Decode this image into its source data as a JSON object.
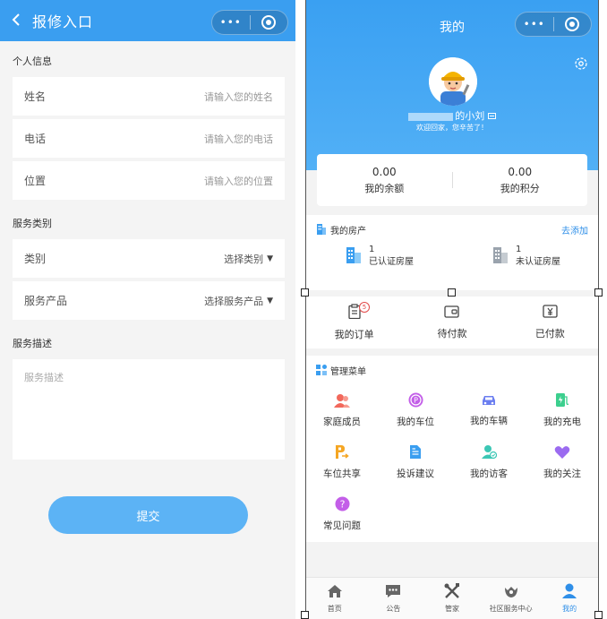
{
  "left": {
    "nav": {
      "back_icon": "chevron-left-icon",
      "title": "报修入口",
      "capsule_dots": "•••"
    },
    "personal": {
      "section_title": "个人信息",
      "fields": [
        {
          "label": "姓名",
          "placeholder": "请输入您的姓名"
        },
        {
          "label": "电话",
          "placeholder": "请输入您的电话"
        },
        {
          "label": "位置",
          "placeholder": "请输入您的位置"
        }
      ]
    },
    "service": {
      "section_title": "服务类别",
      "fields": [
        {
          "label": "类别",
          "value": "选择类别",
          "caret": "▼"
        },
        {
          "label": "服务产品",
          "value": "选择服务产品",
          "caret": "▼"
        }
      ]
    },
    "description": {
      "section_title": "服务描述",
      "placeholder": "服务描述"
    },
    "submit_label": "提交",
    "accent": "#3a9ef0"
  },
  "right": {
    "nav": {
      "title": "我的",
      "capsule_dots": "•••"
    },
    "profile": {
      "name_suffix": "的小刘",
      "verified_icon": "id-card-icon",
      "welcome": "欢迎回家，您辛苦了！"
    },
    "stats": [
      {
        "value": "0.00",
        "label": "我的余额"
      },
      {
        "value": "0.00",
        "label": "我的积分"
      }
    ],
    "property": {
      "title": "我的房产",
      "add_label": "去添加",
      "items": [
        {
          "count": "1",
          "label": "已认证房屋",
          "icon": "building-icon"
        },
        {
          "count": "1",
          "label": "未认证房屋",
          "icon": "building-gray-icon"
        }
      ]
    },
    "orders": [
      {
        "label": "我的订单",
        "icon": "clipboard-icon",
        "badge": "5"
      },
      {
        "label": "待付款",
        "icon": "wallet-icon"
      },
      {
        "label": "已付款",
        "icon": "yen-icon"
      }
    ],
    "menu": {
      "title": "管理菜单",
      "items": [
        {
          "label": "家庭成员",
          "icon": "family-icon",
          "color": "#f2685b"
        },
        {
          "label": "我的车位",
          "icon": "parking-icon",
          "color": "#c35ee8"
        },
        {
          "label": "我的车辆",
          "icon": "car-icon",
          "color": "#6b7ef0"
        },
        {
          "label": "我的充电",
          "icon": "charging-icon",
          "color": "#3ccf8e"
        },
        {
          "label": "车位共享",
          "icon": "parking-share-icon",
          "color": "#f5a623"
        },
        {
          "label": "投诉建议",
          "icon": "complaint-icon",
          "color": "#3a9ef0"
        },
        {
          "label": "我的访客",
          "icon": "visitor-icon",
          "color": "#3cc7b5"
        },
        {
          "label": "我的关注",
          "icon": "heart-icon",
          "color": "#9b6bf0"
        },
        {
          "label": "常见问题",
          "icon": "question-icon",
          "color": "#c35ee8"
        }
      ]
    },
    "tabs": [
      {
        "label": "首页",
        "icon": "home-icon"
      },
      {
        "label": "公告",
        "icon": "message-icon"
      },
      {
        "label": "管家",
        "icon": "tools-icon"
      },
      {
        "label": "社区服务中心",
        "icon": "community-icon"
      },
      {
        "label": "我的",
        "icon": "user-icon",
        "active": true
      }
    ],
    "accent": "#3aa0f2"
  }
}
